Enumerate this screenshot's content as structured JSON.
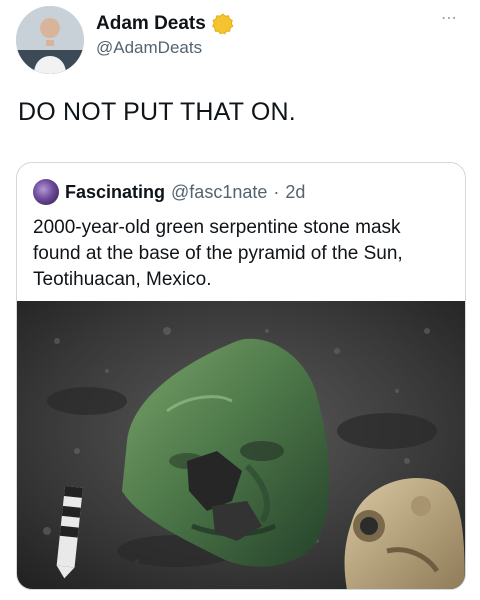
{
  "tweet": {
    "author": {
      "display_name": "Adam Deats",
      "handle": "@AdamDeats",
      "verified_color": "#f4c430"
    },
    "more_icon": "⋯",
    "text": "DO NOT PUT THAT ON."
  },
  "quote": {
    "author": {
      "display_name": "Fascinating",
      "handle": "@fasc1nate"
    },
    "separator": "·",
    "time": "2d",
    "text": "2000-year-old green serpentine stone mask found at the base of the pyramid of the Sun, Teotihuacan, Mexico.",
    "image_icon": "photo-of-green-stone-mask"
  },
  "colors": {
    "text_primary": "#0f1419",
    "text_secondary": "#536471",
    "border": "#cfd9de",
    "mask_green": "#4f7a4a"
  }
}
